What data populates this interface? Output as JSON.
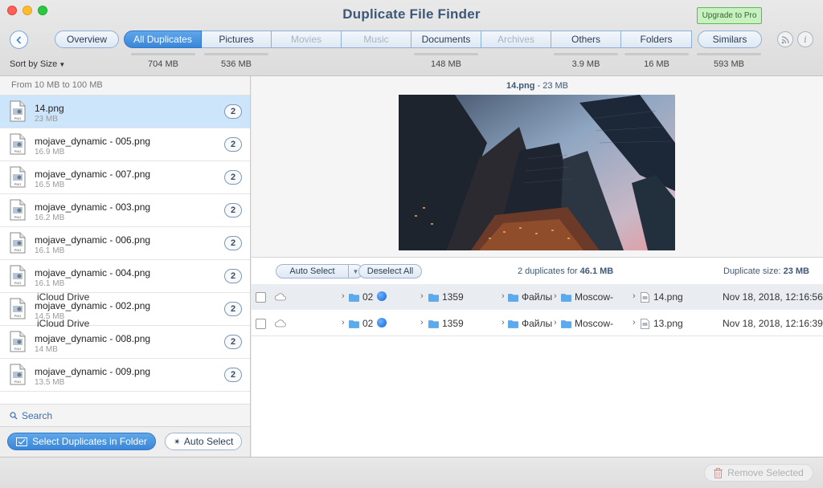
{
  "window": {
    "title": "Duplicate File Finder",
    "upgrade_label": "Upgrade to Pro"
  },
  "tabs": [
    {
      "label": "Overview",
      "size": "",
      "state": "normal"
    },
    {
      "label": "All Duplicates",
      "size": "704 MB",
      "state": "active"
    },
    {
      "label": "Pictures",
      "size": "536 MB",
      "state": "normal"
    },
    {
      "label": "Movies",
      "size": "",
      "state": "disabled"
    },
    {
      "label": "Music",
      "size": "",
      "state": "disabled"
    },
    {
      "label": "Documents",
      "size": "148 MB",
      "state": "normal"
    },
    {
      "label": "Archives",
      "size": "",
      "state": "disabled"
    },
    {
      "label": "Others",
      "size": "3.9 MB",
      "state": "normal"
    },
    {
      "label": "Folders",
      "size": "16 MB",
      "state": "normal"
    },
    {
      "label": "Similars",
      "size": "593 MB",
      "state": "normal"
    }
  ],
  "toolbar": {
    "sort_label": "Sort by Size",
    "info_glyph": "i"
  },
  "left_panel": {
    "range_label": "From 10 MB to 100 MB",
    "files": [
      {
        "name": "14.png",
        "size": "23 MB",
        "count": "2",
        "selected": true
      },
      {
        "name": "mojave_dynamic - 005.png",
        "size": "16.9 MB",
        "count": "2",
        "selected": false
      },
      {
        "name": "mojave_dynamic - 007.png",
        "size": "16.5 MB",
        "count": "2",
        "selected": false
      },
      {
        "name": "mojave_dynamic - 003.png",
        "size": "16.2 MB",
        "count": "2",
        "selected": false
      },
      {
        "name": "mojave_dynamic - 006.png",
        "size": "16.1 MB",
        "count": "2",
        "selected": false
      },
      {
        "name": "mojave_dynamic - 004.png",
        "size": "16.1 MB",
        "count": "2",
        "selected": false
      },
      {
        "name": "mojave_dynamic - 002.png",
        "size": "14.5 MB",
        "count": "2",
        "selected": false
      },
      {
        "name": "mojave_dynamic - 008.png",
        "size": "14 MB",
        "count": "2",
        "selected": false
      },
      {
        "name": "mojave_dynamic - 009.png",
        "size": "13.5 MB",
        "count": "2",
        "selected": false
      }
    ],
    "search_label": "Search",
    "select_folder_label": "Select Duplicates in Folder",
    "auto_select_label": "Auto Select"
  },
  "preview": {
    "file_name": "14.png",
    "file_size": " - 23 MB"
  },
  "actions": {
    "auto_select_label": "Auto Select",
    "deselect_label": "Deselect All",
    "dup_count_text": "2 duplicates for ",
    "dup_count_size": "46.1 MB",
    "dup_size_label": "Duplicate size: ",
    "dup_size_value": "23 MB"
  },
  "duplicates": [
    {
      "drive": "iCloud Drive",
      "f1": "02",
      "f2": "1359",
      "f3": "Файлы",
      "f4": "Moscow-",
      "file": "14.png",
      "date": "Nov 18, 2018, 12:16:56"
    },
    {
      "drive": "iCloud Drive",
      "f1": "02",
      "f2": "1359",
      "f3": "Файлы",
      "f4": "Moscow-",
      "file": "13.png",
      "date": "Nov 18, 2018, 12:16:39"
    }
  ],
  "bottom": {
    "remove_label": "Remove Selected"
  },
  "colors": {
    "accent": "#3b86d8",
    "title": "#3d5878",
    "upgrade_bg": "#c8f0c0"
  }
}
